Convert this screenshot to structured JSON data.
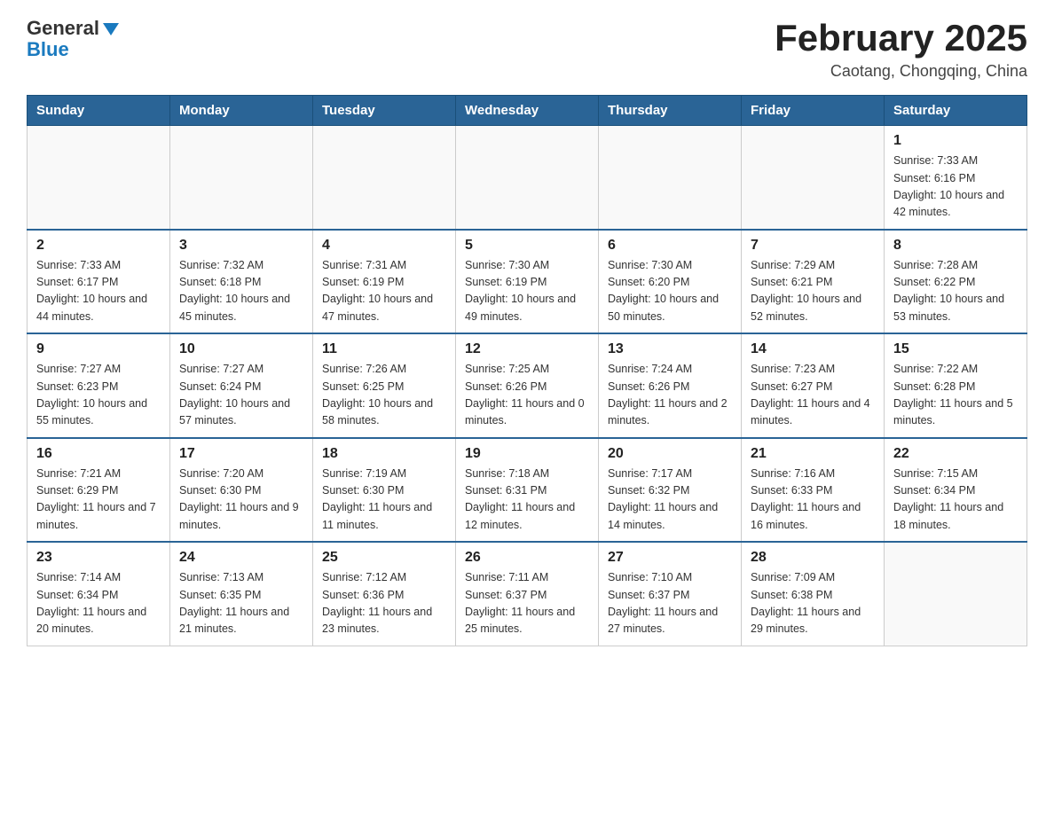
{
  "header": {
    "logo_general": "General",
    "logo_blue": "Blue",
    "title": "February 2025",
    "subtitle": "Caotang, Chongqing, China"
  },
  "days_of_week": [
    "Sunday",
    "Monday",
    "Tuesday",
    "Wednesday",
    "Thursday",
    "Friday",
    "Saturday"
  ],
  "weeks": [
    [
      {
        "day": "",
        "sunrise": "",
        "sunset": "",
        "daylight": "",
        "empty": true
      },
      {
        "day": "",
        "sunrise": "",
        "sunset": "",
        "daylight": "",
        "empty": true
      },
      {
        "day": "",
        "sunrise": "",
        "sunset": "",
        "daylight": "",
        "empty": true
      },
      {
        "day": "",
        "sunrise": "",
        "sunset": "",
        "daylight": "",
        "empty": true
      },
      {
        "day": "",
        "sunrise": "",
        "sunset": "",
        "daylight": "",
        "empty": true
      },
      {
        "day": "",
        "sunrise": "",
        "sunset": "",
        "daylight": "",
        "empty": true
      },
      {
        "day": "1",
        "sunrise": "Sunrise: 7:33 AM",
        "sunset": "Sunset: 6:16 PM",
        "daylight": "Daylight: 10 hours and 42 minutes.",
        "empty": false
      }
    ],
    [
      {
        "day": "2",
        "sunrise": "Sunrise: 7:33 AM",
        "sunset": "Sunset: 6:17 PM",
        "daylight": "Daylight: 10 hours and 44 minutes.",
        "empty": false
      },
      {
        "day": "3",
        "sunrise": "Sunrise: 7:32 AM",
        "sunset": "Sunset: 6:18 PM",
        "daylight": "Daylight: 10 hours and 45 minutes.",
        "empty": false
      },
      {
        "day": "4",
        "sunrise": "Sunrise: 7:31 AM",
        "sunset": "Sunset: 6:19 PM",
        "daylight": "Daylight: 10 hours and 47 minutes.",
        "empty": false
      },
      {
        "day": "5",
        "sunrise": "Sunrise: 7:30 AM",
        "sunset": "Sunset: 6:19 PM",
        "daylight": "Daylight: 10 hours and 49 minutes.",
        "empty": false
      },
      {
        "day": "6",
        "sunrise": "Sunrise: 7:30 AM",
        "sunset": "Sunset: 6:20 PM",
        "daylight": "Daylight: 10 hours and 50 minutes.",
        "empty": false
      },
      {
        "day": "7",
        "sunrise": "Sunrise: 7:29 AM",
        "sunset": "Sunset: 6:21 PM",
        "daylight": "Daylight: 10 hours and 52 minutes.",
        "empty": false
      },
      {
        "day": "8",
        "sunrise": "Sunrise: 7:28 AM",
        "sunset": "Sunset: 6:22 PM",
        "daylight": "Daylight: 10 hours and 53 minutes.",
        "empty": false
      }
    ],
    [
      {
        "day": "9",
        "sunrise": "Sunrise: 7:27 AM",
        "sunset": "Sunset: 6:23 PM",
        "daylight": "Daylight: 10 hours and 55 minutes.",
        "empty": false
      },
      {
        "day": "10",
        "sunrise": "Sunrise: 7:27 AM",
        "sunset": "Sunset: 6:24 PM",
        "daylight": "Daylight: 10 hours and 57 minutes.",
        "empty": false
      },
      {
        "day": "11",
        "sunrise": "Sunrise: 7:26 AM",
        "sunset": "Sunset: 6:25 PM",
        "daylight": "Daylight: 10 hours and 58 minutes.",
        "empty": false
      },
      {
        "day": "12",
        "sunrise": "Sunrise: 7:25 AM",
        "sunset": "Sunset: 6:26 PM",
        "daylight": "Daylight: 11 hours and 0 minutes.",
        "empty": false
      },
      {
        "day": "13",
        "sunrise": "Sunrise: 7:24 AM",
        "sunset": "Sunset: 6:26 PM",
        "daylight": "Daylight: 11 hours and 2 minutes.",
        "empty": false
      },
      {
        "day": "14",
        "sunrise": "Sunrise: 7:23 AM",
        "sunset": "Sunset: 6:27 PM",
        "daylight": "Daylight: 11 hours and 4 minutes.",
        "empty": false
      },
      {
        "day": "15",
        "sunrise": "Sunrise: 7:22 AM",
        "sunset": "Sunset: 6:28 PM",
        "daylight": "Daylight: 11 hours and 5 minutes.",
        "empty": false
      }
    ],
    [
      {
        "day": "16",
        "sunrise": "Sunrise: 7:21 AM",
        "sunset": "Sunset: 6:29 PM",
        "daylight": "Daylight: 11 hours and 7 minutes.",
        "empty": false
      },
      {
        "day": "17",
        "sunrise": "Sunrise: 7:20 AM",
        "sunset": "Sunset: 6:30 PM",
        "daylight": "Daylight: 11 hours and 9 minutes.",
        "empty": false
      },
      {
        "day": "18",
        "sunrise": "Sunrise: 7:19 AM",
        "sunset": "Sunset: 6:30 PM",
        "daylight": "Daylight: 11 hours and 11 minutes.",
        "empty": false
      },
      {
        "day": "19",
        "sunrise": "Sunrise: 7:18 AM",
        "sunset": "Sunset: 6:31 PM",
        "daylight": "Daylight: 11 hours and 12 minutes.",
        "empty": false
      },
      {
        "day": "20",
        "sunrise": "Sunrise: 7:17 AM",
        "sunset": "Sunset: 6:32 PM",
        "daylight": "Daylight: 11 hours and 14 minutes.",
        "empty": false
      },
      {
        "day": "21",
        "sunrise": "Sunrise: 7:16 AM",
        "sunset": "Sunset: 6:33 PM",
        "daylight": "Daylight: 11 hours and 16 minutes.",
        "empty": false
      },
      {
        "day": "22",
        "sunrise": "Sunrise: 7:15 AM",
        "sunset": "Sunset: 6:34 PM",
        "daylight": "Daylight: 11 hours and 18 minutes.",
        "empty": false
      }
    ],
    [
      {
        "day": "23",
        "sunrise": "Sunrise: 7:14 AM",
        "sunset": "Sunset: 6:34 PM",
        "daylight": "Daylight: 11 hours and 20 minutes.",
        "empty": false
      },
      {
        "day": "24",
        "sunrise": "Sunrise: 7:13 AM",
        "sunset": "Sunset: 6:35 PM",
        "daylight": "Daylight: 11 hours and 21 minutes.",
        "empty": false
      },
      {
        "day": "25",
        "sunrise": "Sunrise: 7:12 AM",
        "sunset": "Sunset: 6:36 PM",
        "daylight": "Daylight: 11 hours and 23 minutes.",
        "empty": false
      },
      {
        "day": "26",
        "sunrise": "Sunrise: 7:11 AM",
        "sunset": "Sunset: 6:37 PM",
        "daylight": "Daylight: 11 hours and 25 minutes.",
        "empty": false
      },
      {
        "day": "27",
        "sunrise": "Sunrise: 7:10 AM",
        "sunset": "Sunset: 6:37 PM",
        "daylight": "Daylight: 11 hours and 27 minutes.",
        "empty": false
      },
      {
        "day": "28",
        "sunrise": "Sunrise: 7:09 AM",
        "sunset": "Sunset: 6:38 PM",
        "daylight": "Daylight: 11 hours and 29 minutes.",
        "empty": false
      },
      {
        "day": "",
        "sunrise": "",
        "sunset": "",
        "daylight": "",
        "empty": true
      }
    ]
  ]
}
